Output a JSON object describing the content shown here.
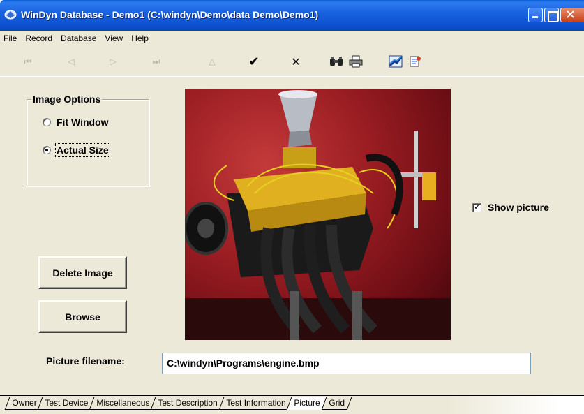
{
  "window": {
    "title": "WinDyn Database - Demo1  (C:\\windyn\\Demo\\data Demo\\Demo1)",
    "close_glyph": "✕"
  },
  "menu": [
    "File",
    "Record",
    "Database",
    "View",
    "Help"
  ],
  "toolbar": {
    "first": "⏮",
    "prev": "◁",
    "next": "▷",
    "last": "⏭",
    "up": "△",
    "check": "✔",
    "cancel": "✕",
    "find": "🔍",
    "print": "🖶",
    "chart": "📈",
    "report": "📋"
  },
  "image_options": {
    "legend": "Image Options",
    "fit_window": "Fit Window",
    "actual_size": "Actual Size",
    "selected": "actual_size"
  },
  "show_picture": {
    "label": "Show picture",
    "checked": true,
    "mark": "✓"
  },
  "buttons": {
    "delete_image": "Delete Image",
    "browse": "Browse"
  },
  "picture_filename": {
    "label": "Picture filename:",
    "value": "C:\\windyn\\Programs\\engine.bmp"
  },
  "tabs": [
    "Owner",
    "Test Device",
    "Miscellaneous",
    "Test Description",
    "Test Information",
    "Picture",
    "Grid"
  ],
  "active_tab": "Picture",
  "colors": {
    "titlebar": "#0b4fcf",
    "face": "#ece9d8",
    "backdrop": "#9a1d22",
    "engine_block": "#e0b020"
  }
}
